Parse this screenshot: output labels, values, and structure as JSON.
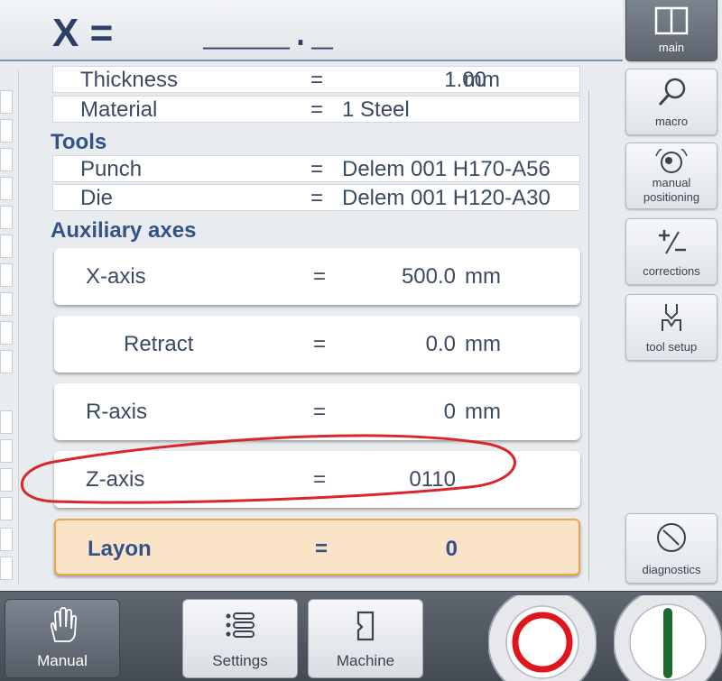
{
  "header": {
    "axis_label": "X =",
    "axis_value": "____._"
  },
  "parameters": {
    "thickness": {
      "label": "Thickness",
      "eq": "=",
      "value": "1.00",
      "unit": "mm"
    },
    "material": {
      "label": "Material",
      "eq": "=",
      "value": "1 Steel"
    }
  },
  "tools": {
    "title": "Tools",
    "punch": {
      "label": "Punch",
      "eq": "=",
      "value": "Delem 001 H170-A56"
    },
    "die": {
      "label": "Die",
      "eq": "=",
      "value": "Delem 001 H120-A30"
    }
  },
  "aux": {
    "title": "Auxiliary axes",
    "rows": [
      {
        "label": "X-axis",
        "eq": "=",
        "value": "500.0",
        "unit": "mm"
      },
      {
        "label": "Retract",
        "eq": "=",
        "value": "0.0",
        "unit": "mm"
      },
      {
        "label": "R-axis",
        "eq": "=",
        "value": "0",
        "unit": "mm"
      },
      {
        "label": "Z-axis",
        "eq": "=",
        "value": "0110",
        "unit": ""
      },
      {
        "label": "Layon",
        "eq": "=",
        "value": "0",
        "unit": ""
      }
    ]
  },
  "sidebar": {
    "main": "main",
    "macro": "macro",
    "manual_positioning": "manual\npositioning",
    "corrections": "corrections",
    "tool_setup": "tool setup",
    "diagnostics": "diagnostics"
  },
  "bottom": {
    "manual": "Manual",
    "settings": "Settings",
    "machine": "Machine"
  },
  "colors": {
    "annotation": "#d9262b",
    "stop": "#e0161d",
    "start": "#1d6b2e",
    "selected_bg": "#fbe3c8",
    "selected_border": "#f0a34b"
  }
}
